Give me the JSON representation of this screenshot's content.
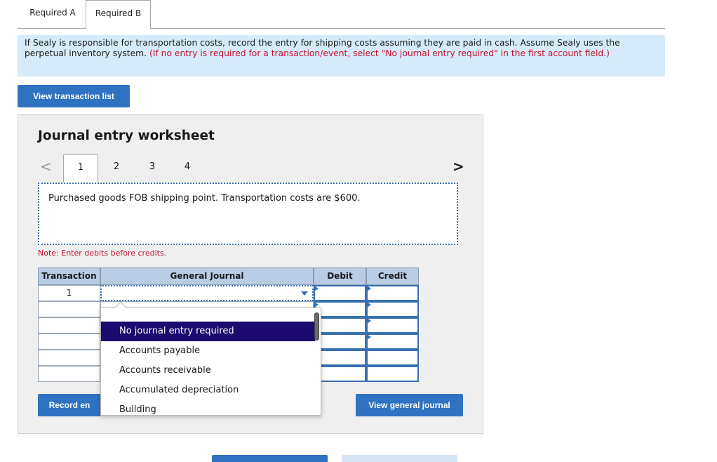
{
  "tabs": [
    {
      "label": "Required A"
    },
    {
      "label": "Required B"
    }
  ],
  "instructions": {
    "main": "If Sealy is responsible for transportation costs, record the entry for shipping costs assuming they are paid in cash. Assume Sealy uses the perpetual inventory system.",
    "hint": "(If no entry is required for a transaction/event, select \"No journal entry required\" in the first account field.)"
  },
  "buttons": {
    "view_transaction_list": "View transaction list",
    "record_entry": "Record en",
    "view_general_journal": "View general journal"
  },
  "worksheet": {
    "title": "Journal entry worksheet",
    "pages": [
      "1",
      "2",
      "3",
      "4"
    ],
    "nav_prev": "<",
    "nav_next": ">",
    "description": "Purchased goods FOB shipping point. Transportation costs are $600.",
    "note": "Note: Enter debits before credits."
  },
  "table": {
    "headers": {
      "transaction": "Transaction",
      "general_journal": "General Journal",
      "debit": "Debit",
      "credit": "Credit"
    },
    "rows": [
      {
        "transaction": "1"
      },
      {
        "transaction": ""
      },
      {
        "transaction": ""
      },
      {
        "transaction": ""
      },
      {
        "transaction": ""
      },
      {
        "transaction": ""
      }
    ]
  },
  "dropdown": {
    "options": [
      "No journal entry required",
      "Accounts payable",
      "Accounts receivable",
      "Accumulated depreciation",
      "Building"
    ],
    "selected": "No journal entry required"
  },
  "colors": {
    "accent": "#2f72c2",
    "header_bg": "#b9cce4",
    "instruction_bg": "#d6ebfa",
    "selected": "#1c0a6e",
    "error_red": "#c8102e"
  }
}
